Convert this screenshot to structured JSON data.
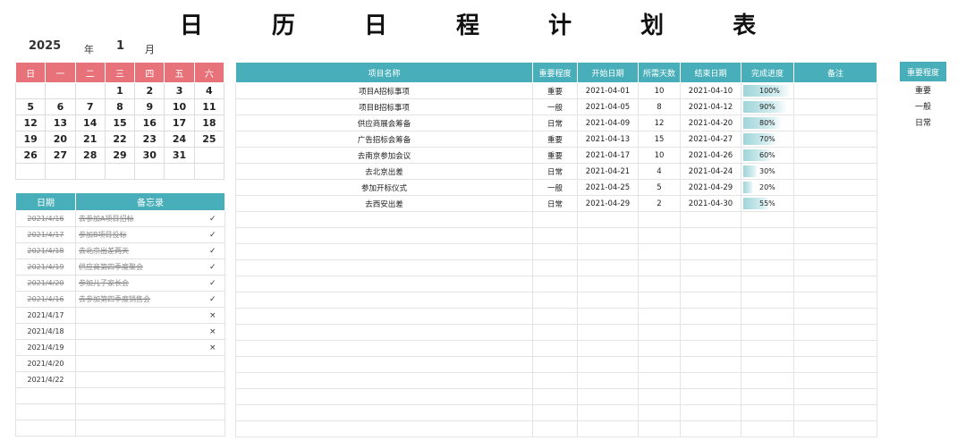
{
  "title": "日 历 日 程 计 划 表",
  "calendar": {
    "year": "2025",
    "year_label": "年",
    "month": "1",
    "month_label": "月",
    "weekdays": [
      "日",
      "一",
      "二",
      "三",
      "四",
      "五",
      "六"
    ],
    "weeks": [
      [
        "",
        "",
        "",
        "1",
        "2",
        "3",
        "4"
      ],
      [
        "5",
        "6",
        "7",
        "8",
        "9",
        "10",
        "11"
      ],
      [
        "12",
        "13",
        "14",
        "15",
        "16",
        "17",
        "18"
      ],
      [
        "19",
        "20",
        "21",
        "22",
        "23",
        "24",
        "25"
      ],
      [
        "26",
        "27",
        "28",
        "29",
        "30",
        "31",
        ""
      ],
      [
        "",
        "",
        "",
        "",
        "",
        "",
        ""
      ]
    ]
  },
  "memo": {
    "headers": [
      "日期",
      "备忘录"
    ],
    "rows": [
      {
        "date": "2021/4/16",
        "text": "去参加A项目招标",
        "mark": "✓",
        "done": true
      },
      {
        "date": "2021/4/17",
        "text": "参加B项目投标",
        "mark": "✓",
        "done": true
      },
      {
        "date": "2021/4/18",
        "text": "去北京出差两天",
        "mark": "✓",
        "done": true
      },
      {
        "date": "2021/4/19",
        "text": "供应商第四季度聚会",
        "mark": "✓",
        "done": true
      },
      {
        "date": "2021/4/20",
        "text": "参加儿子家长会",
        "mark": "✓",
        "done": true
      },
      {
        "date": "2021/4/16",
        "text": "去参加第四季度销售会",
        "mark": "✓",
        "done": true
      },
      {
        "date": "2021/4/17",
        "text": "",
        "mark": "×",
        "done": false
      },
      {
        "date": "2021/4/18",
        "text": "",
        "mark": "×",
        "done": false
      },
      {
        "date": "2021/4/19",
        "text": "",
        "mark": "×",
        "done": false
      },
      {
        "date": "2021/4/20",
        "text": "",
        "mark": "",
        "done": false
      },
      {
        "date": "2021/4/22",
        "text": "",
        "mark": "",
        "done": false
      },
      {
        "date": "",
        "text": "",
        "mark": "",
        "done": false
      },
      {
        "date": "",
        "text": "",
        "mark": "",
        "done": false
      },
      {
        "date": "",
        "text": "",
        "mark": "",
        "done": false
      }
    ]
  },
  "projects": {
    "headers": [
      "项目名称",
      "重要程度",
      "开始日期",
      "所需天数",
      "结束日期",
      "完成进度",
      "备注"
    ],
    "rows": [
      {
        "name": "项目A招标事项",
        "priority": "重要",
        "start": "2021-04-01",
        "days": "10",
        "end": "2021-04-10",
        "progress": 1.0,
        "progress_label": "100%",
        "note": ""
      },
      {
        "name": "项目B招标事项",
        "priority": "一般",
        "start": "2021-04-05",
        "days": "8",
        "end": "2021-04-12",
        "progress": 0.9,
        "progress_label": "90%",
        "note": ""
      },
      {
        "name": "供应商展会筹备",
        "priority": "日常",
        "start": "2021-04-09",
        "days": "12",
        "end": "2021-04-20",
        "progress": 0.8,
        "progress_label": "80%",
        "note": ""
      },
      {
        "name": "广告招标会筹备",
        "priority": "重要",
        "start": "2021-04-13",
        "days": "15",
        "end": "2021-04-27",
        "progress": 0.7,
        "progress_label": "70%",
        "note": ""
      },
      {
        "name": "去南京参加会议",
        "priority": "重要",
        "start": "2021-04-17",
        "days": "10",
        "end": "2021-04-26",
        "progress": 0.6,
        "progress_label": "60%",
        "note": ""
      },
      {
        "name": "去北京出差",
        "priority": "日常",
        "start": "2021-04-21",
        "days": "4",
        "end": "2021-04-24",
        "progress": 0.3,
        "progress_label": "30%",
        "note": ""
      },
      {
        "name": "参加开标仪式",
        "priority": "一般",
        "start": "2021-04-25",
        "days": "5",
        "end": "2021-04-29",
        "progress": 0.2,
        "progress_label": "20%",
        "note": ""
      },
      {
        "name": "去西安出差",
        "priority": "日常",
        "start": "2021-04-29",
        "days": "2",
        "end": "2021-04-30",
        "progress": 0.55,
        "progress_label": "55%",
        "note": ""
      }
    ],
    "empty_rows": 14
  },
  "legend": {
    "header": "重要程度",
    "items": [
      "重要",
      "一般",
      "日常"
    ]
  },
  "colors": {
    "calendar_header": "#e8727a",
    "table_header": "#48afba",
    "progress_fill": "#9fd5d9"
  }
}
